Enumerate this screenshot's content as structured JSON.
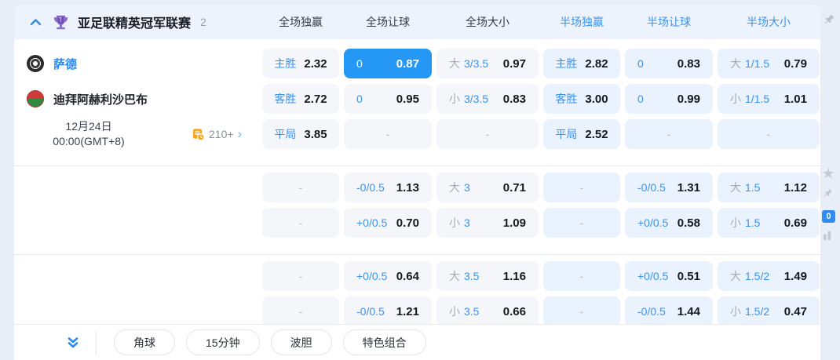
{
  "header": {
    "title": "亚足联精英冠军联赛",
    "count": "2",
    "columns": [
      "全场独赢",
      "全场让球",
      "全场大小",
      "半场独赢",
      "半场让球",
      "半场大小"
    ]
  },
  "match": {
    "home": "萨德",
    "away": "迪拜阿赫利沙巴布",
    "date": "12月24日",
    "time": "00:00(GMT+8)",
    "more_markets": "210+"
  },
  "odds": {
    "groups": [
      {
        "rows": [
          {
            "info": "home",
            "cells": [
              {
                "type": "win",
                "label": "主胜",
                "value": "2.32"
              },
              {
                "type": "hcp",
                "label": "0",
                "value": "0.87",
                "selected": true
              },
              {
                "type": "ou",
                "side": "大",
                "line": "3/3.5",
                "value": "0.97"
              },
              {
                "type": "win",
                "label": "主胜",
                "value": "2.82"
              },
              {
                "type": "hcp",
                "label": "0",
                "value": "0.83"
              },
              {
                "type": "ou",
                "side": "大",
                "line": "1/1.5",
                "value": "0.79"
              }
            ]
          },
          {
            "info": "away",
            "cells": [
              {
                "type": "win",
                "label": "客胜",
                "value": "2.72"
              },
              {
                "type": "hcp",
                "label": "0",
                "value": "0.95"
              },
              {
                "type": "ou",
                "side": "小",
                "line": "3/3.5",
                "value": "0.83"
              },
              {
                "type": "win",
                "label": "客胜",
                "value": "3.00"
              },
              {
                "type": "hcp",
                "label": "0",
                "value": "0.99"
              },
              {
                "type": "ou",
                "side": "小",
                "line": "1/1.5",
                "value": "1.01"
              }
            ]
          },
          {
            "info": "meta",
            "cells": [
              {
                "type": "win",
                "label": "平局",
                "value": "3.85"
              },
              {
                "type": "dash"
              },
              {
                "type": "dash"
              },
              {
                "type": "win",
                "label": "平局",
                "value": "2.52"
              },
              {
                "type": "dash"
              },
              {
                "type": "dash"
              }
            ]
          }
        ]
      },
      {
        "rows": [
          {
            "info": null,
            "cells": [
              {
                "type": "dash"
              },
              {
                "type": "hcp",
                "label": "-0/0.5",
                "value": "1.13"
              },
              {
                "type": "ou",
                "side": "大",
                "line": "3",
                "value": "0.71"
              },
              {
                "type": "dash"
              },
              {
                "type": "hcp",
                "label": "-0/0.5",
                "value": "1.31"
              },
              {
                "type": "ou",
                "side": "大",
                "line": "1.5",
                "value": "1.12"
              }
            ]
          },
          {
            "info": null,
            "cells": [
              {
                "type": "dash"
              },
              {
                "type": "hcp",
                "label": "+0/0.5",
                "value": "0.70"
              },
              {
                "type": "ou",
                "side": "小",
                "line": "3",
                "value": "1.09"
              },
              {
                "type": "dash"
              },
              {
                "type": "hcp",
                "label": "+0/0.5",
                "value": "0.58"
              },
              {
                "type": "ou",
                "side": "小",
                "line": "1.5",
                "value": "0.69"
              }
            ]
          }
        ]
      },
      {
        "rows": [
          {
            "info": null,
            "cells": [
              {
                "type": "dash"
              },
              {
                "type": "hcp",
                "label": "+0/0.5",
                "value": "0.64"
              },
              {
                "type": "ou",
                "side": "大",
                "line": "3.5",
                "value": "1.16"
              },
              {
                "type": "dash"
              },
              {
                "type": "hcp",
                "label": "+0/0.5",
                "value": "0.51"
              },
              {
                "type": "ou",
                "side": "大",
                "line": "1.5/2",
                "value": "1.49"
              }
            ]
          },
          {
            "info": null,
            "cells": [
              {
                "type": "dash"
              },
              {
                "type": "hcp",
                "label": "-0/0.5",
                "value": "1.21"
              },
              {
                "type": "ou",
                "side": "小",
                "line": "3.5",
                "value": "0.66"
              },
              {
                "type": "dash"
              },
              {
                "type": "hcp",
                "label": "-0/0.5",
                "value": "1.44"
              },
              {
                "type": "ou",
                "side": "小",
                "line": "1.5/2",
                "value": "0.47"
              }
            ]
          }
        ]
      }
    ]
  },
  "footer": {
    "buttons": [
      "角球",
      "15分钟",
      "波胆",
      "特色组合"
    ]
  },
  "rail": {
    "badge": "0"
  },
  "colors": {
    "accent_blue": "#2e8cf0",
    "selected_cell_bg": "#2598f5",
    "full_cell_bg": "#f4f6f9",
    "half_cell_bg": "#e9f2fd",
    "header_bg": "#edf3fc",
    "page_bg": "#e8eef8",
    "trophy_purple": "#7c5bc0",
    "markets_orange": "#f5a623"
  }
}
